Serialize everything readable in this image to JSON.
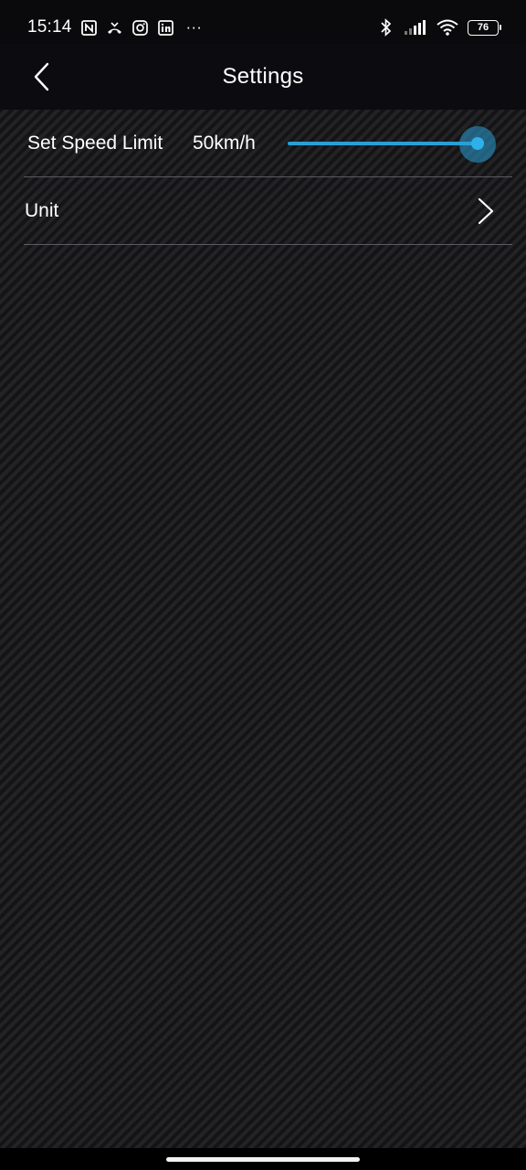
{
  "status_bar": {
    "time": "15:14",
    "more": "···",
    "battery": "76",
    "notification_icons": [
      "nfc-icon",
      "missed-call-icon",
      "instagram-icon",
      "linkedin-icon"
    ],
    "system_icons": [
      "bluetooth-icon",
      "signal-icon",
      "wifi-icon",
      "battery-icon"
    ]
  },
  "header": {
    "title": "Settings"
  },
  "speed_limit": {
    "label": "Set Speed Limit",
    "value": "50km/h",
    "slider_fraction": 1.0
  },
  "unit": {
    "label": "Unit"
  },
  "colors": {
    "accent": "#2a9fd6",
    "background": "#1c1c1e",
    "header_bg": "#0c0b10",
    "divider": "#5a5a60"
  }
}
